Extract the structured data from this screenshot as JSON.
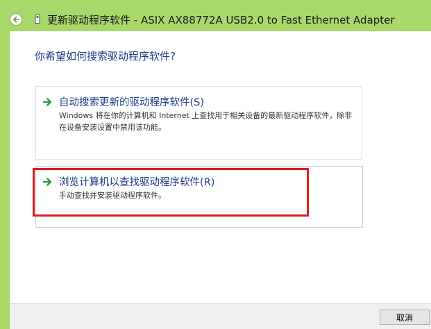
{
  "window": {
    "title": "更新驱动程序软件 - ASIX AX88772A USB2.0 to Fast Ethernet Adapter"
  },
  "content": {
    "question": "你希望如何搜索驱动程序软件?"
  },
  "options": [
    {
      "title": "自动搜索更新的驱动程序软件(S)",
      "description": "Windows 将在你的计算机和 Internet 上查找用于相关设备的最新驱动程序软件，除非在设备安装设置中禁用该功能。"
    },
    {
      "title": "浏览计算机以查找驱动程序软件(R)",
      "description": "手动查找并安装驱动程序软件。"
    }
  ],
  "footer": {
    "cancel_label": "取消"
  },
  "colors": {
    "window_frame": "#a8d86a",
    "link_text": "#1e3a8a",
    "highlight": "#e21a1a",
    "arrow": "#2e9e3a"
  }
}
